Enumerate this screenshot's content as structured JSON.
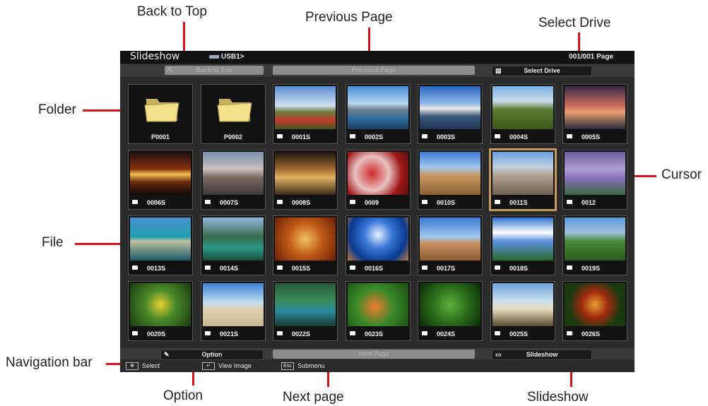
{
  "callouts": {
    "back_to_top": "Back to Top",
    "previous_page": "Previous Page",
    "select_drive": "Select Drive",
    "folder": "Folder",
    "cursor": "Cursor",
    "file": "File",
    "navigation_bar": "Navigation bar",
    "option": "Option",
    "next_page": "Next page",
    "slideshow": "Slideshow"
  },
  "screen": {
    "title": "Slideshow",
    "path": "USB1>",
    "page": "001/001 Page",
    "top_bar": {
      "back_to_top": "Back to Top",
      "previous_page": "Previous Page",
      "select_drive": "Select Drive"
    },
    "bottom_bar": {
      "option": "Option",
      "next_page": "Next Page",
      "slideshow": "Slideshow"
    },
    "help": {
      "select": "Select",
      "view_image": "View Image",
      "submenu": "Submenu"
    }
  },
  "thumbnails": [
    "P0001",
    "P0002",
    "0001S",
    "0002S",
    "0003S",
    "0004S",
    "0005S",
    "0006S",
    "0007S",
    "0008S",
    "0009",
    "0010S",
    "0011S",
    "0012",
    "0013S",
    "0014S",
    "0015S",
    "0016S",
    "0017S",
    "0018S",
    "0019S",
    "0020S",
    "0021S",
    "0022S",
    "0023S",
    "0024S",
    "0025S",
    "0026S"
  ],
  "colors": {
    "accent_red": "#d8121a",
    "cursor_border": "#c79a5a"
  }
}
